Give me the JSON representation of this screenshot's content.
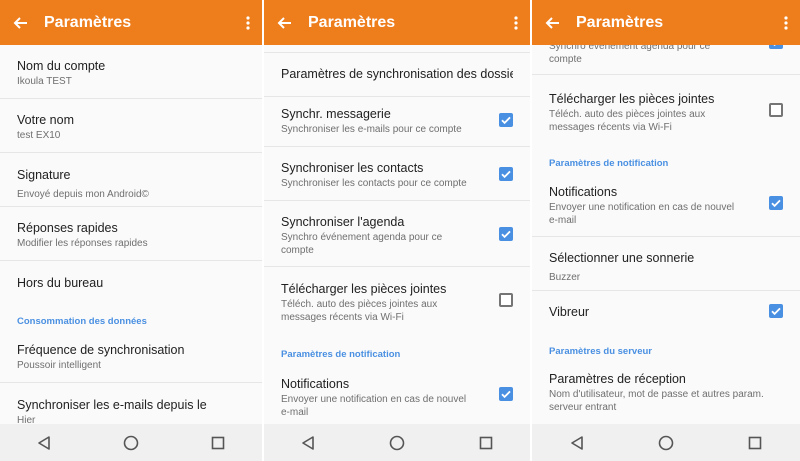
{
  "colors": {
    "appbar": "#ee7d1c",
    "accent": "#4a90e2",
    "navbar": "#f0f0f0"
  },
  "panel1": {
    "title": "Paramètres",
    "items": [
      {
        "title": "Nom du compte",
        "subtitle": "Ikoula TEST"
      },
      {
        "title": "Votre nom",
        "subtitle": "test EX10"
      },
      {
        "title": "Signature",
        "subtitle": "Envoyé depuis mon Android©"
      },
      {
        "title": "Réponses rapides",
        "subtitle": "Modifier les réponses rapides"
      },
      {
        "title": "Hors du bureau"
      }
    ],
    "section": "Consommation des données",
    "items2": [
      {
        "title": "Fréquence de synchronisation",
        "subtitle": "Poussoir intelligent"
      },
      {
        "title": "Synchroniser les e-mails depuis le",
        "subtitle": "Hier"
      }
    ]
  },
  "panel2": {
    "title": "Paramètres",
    "items": [
      {
        "title": "Paramètres de synchronisation des dossie..."
      },
      {
        "title": "Synchr. messagerie",
        "subtitle": "Synchroniser les e-mails pour ce compte",
        "checked": true
      },
      {
        "title": "Synchroniser les contacts",
        "subtitle": "Synchroniser les contacts pour ce compte",
        "checked": true
      },
      {
        "title": "Synchroniser l'agenda",
        "subtitle": "Synchro événement agenda pour ce compte",
        "checked": true
      },
      {
        "title": "Télécharger les pièces jointes",
        "subtitle": "Téléch. auto des pièces jointes aux messages récents via Wi-Fi",
        "checked": false
      }
    ],
    "section": "Paramètres de notification",
    "items2": [
      {
        "title": "Notifications",
        "subtitle": "Envoyer une notification en cas de nouvel e-mail",
        "checked": true
      }
    ]
  },
  "panel3": {
    "title": "Paramètres",
    "items": [
      {
        "subtitle": "Synchro événement agenda pour ce compte",
        "checked": true
      },
      {
        "title": "Télécharger les pièces jointes",
        "subtitle": "Téléch. auto des pièces jointes aux messages récents via Wi-Fi",
        "checked": false
      }
    ],
    "section1": "Paramètres de notification",
    "items2": [
      {
        "title": "Notifications",
        "subtitle": "Envoyer une notification en cas de nouvel e-mail",
        "checked": true
      },
      {
        "title": "Sélectionner une sonnerie",
        "subtitle": "Buzzer"
      },
      {
        "title": "Vibreur",
        "checked": true
      }
    ],
    "section2": "Paramètres du serveur",
    "items3": [
      {
        "title": "Paramètres de réception",
        "subtitle": "Nom d'utilisateur, mot de passe et autres param. serveur entrant"
      }
    ]
  },
  "icons": {
    "back": "arrow-back-icon",
    "menu": "more-vert-icon",
    "nav_back": "triangle-back-icon",
    "nav_home": "circle-home-icon",
    "nav_recent": "square-recents-icon"
  }
}
